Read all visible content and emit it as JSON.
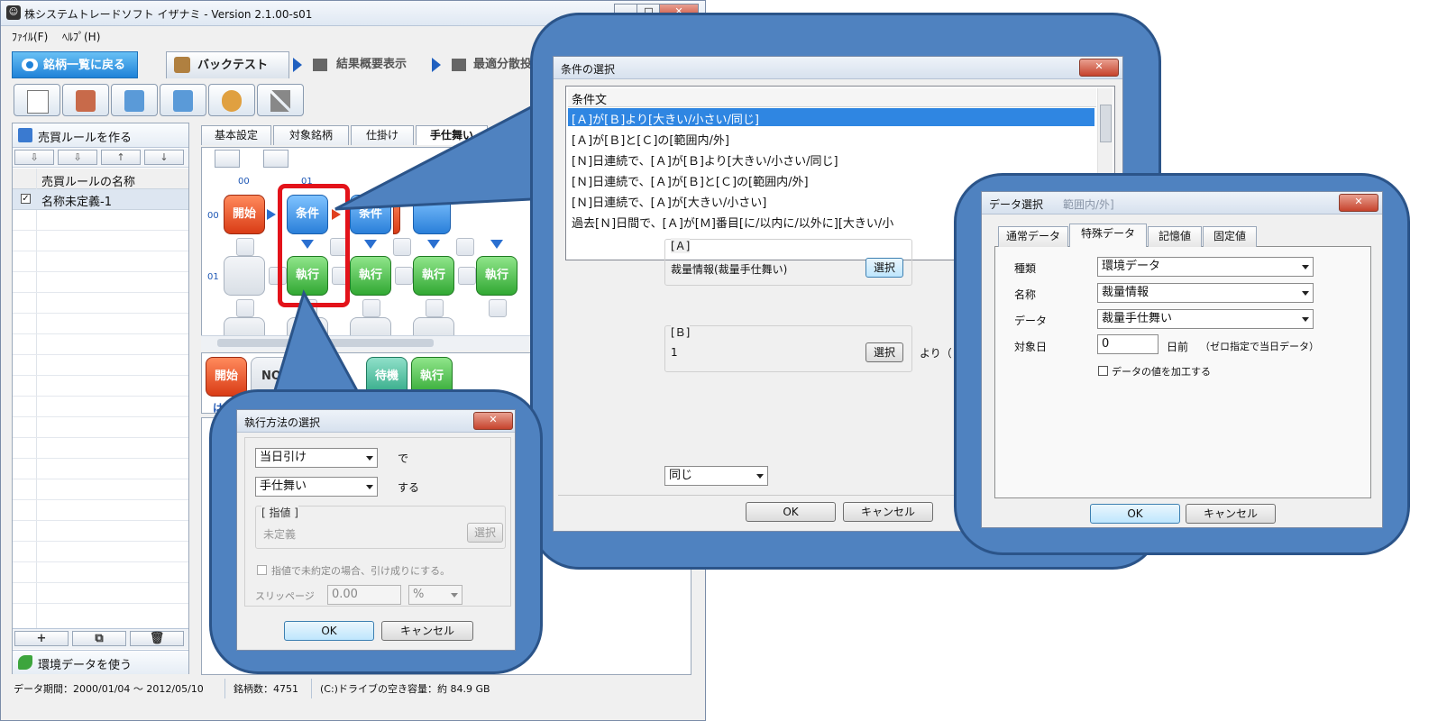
{
  "window": {
    "title": "株システムトレードソフト イザナミ - Version 2.1.00-s01",
    "min": "_",
    "max": "□",
    "close": "✕"
  },
  "menu": {
    "file": "ﾌｧｲﾙ(F)",
    "help": "ﾍﾙﾌﾟ(H)"
  },
  "nav": {
    "back": "銘柄一覧に戻る",
    "backtest": "バックテスト",
    "summary": "結果概要表示",
    "optimize": "最適分散投"
  },
  "left_panel": {
    "header": "売買ルールを作る",
    "column_header": "売買ルールの名称",
    "rows": [
      {
        "checked": true,
        "check_mark": "✓",
        "name": "名称未定義-1"
      }
    ],
    "tools": [
      "⇩",
      "⇩",
      "↑",
      "↓"
    ],
    "bottom_buttons": [
      "+",
      "⧉",
      "🗑"
    ],
    "footer": "環境データを使う"
  },
  "tabs": [
    "基本設定",
    "対象銘柄",
    "仕掛け",
    "手仕舞い"
  ],
  "grid": {
    "col_labels": [
      "00",
      "01"
    ],
    "row_labels": [
      "00",
      "01"
    ],
    "row0": [
      "開始",
      "条件",
      "条件",
      "",
      ""
    ],
    "row1": [
      "",
      "執行",
      "執行",
      "執行",
      "執行"
    ]
  },
  "palette": {
    "items": [
      "開始",
      "NO",
      "待機",
      "執行"
    ],
    "hint": "は"
  },
  "status": {
    "period": "データ期間：2000/01/04 〜 2012/05/10",
    "count": "銘柄数：4751",
    "disk": "(C:)ドライブの空き容量：約 84.9 GB"
  },
  "dialog_cond": {
    "title": "条件の選択",
    "list_header": "条件文",
    "items": [
      "[Ａ]が[Ｂ]より[大きい/小さい/同じ]",
      "[Ａ]が[Ｂ]と[Ｃ]の[範囲内/外]",
      "[Ｎ]日連続で、[Ａ]が[Ｂ]より[大きい/小さい/同じ]",
      "[Ｎ]日連続で、[Ａ]が[Ｂ]と[Ｃ]の[範囲内/外]",
      "[Ｎ]日連続で、[Ａ]が[大きい/小さい]",
      "過去[Ｎ]日間で、[Ａ]が[Ｍ]番目[に/以内に/以外に][大きい/小"
    ],
    "group_a_label": "[Ａ]",
    "group_a_value": "裁量情報(裁量手仕舞い)",
    "group_b_label": "[Ｂ]",
    "group_b_value": "1",
    "yori": "より（",
    "select_label": "選択",
    "compare": "同じ",
    "ok": "OK",
    "cancel": "キャンセル"
  },
  "dialog_data": {
    "title": "データ選択",
    "title_faded": "範囲内/外]",
    "tabs": [
      "通常データ",
      "特殊データ",
      "記憶値",
      "固定値"
    ],
    "type_label": "種類",
    "type_value": "環境データ",
    "name_label": "名称",
    "name_value": "裁量情報",
    "data_label": "データ",
    "data_value": "裁量手仕舞い",
    "date_label": "対象日",
    "date_value": "0",
    "date_suffix": "日前",
    "date_note": "（ゼロ指定で当日データ）",
    "process_label": "データの値を加工する",
    "ok": "OK",
    "cancel": "キャンセル"
  },
  "dialog_exec": {
    "title": "執行方法の選択",
    "timing": "当日引け",
    "de": "で",
    "method": "手仕舞い",
    "suru": "する",
    "limit_group": "[ 指値 ]",
    "limit_value": "未定義",
    "select_label": "選択",
    "unfilled_label": "指値で未約定の場合、引け成りにする。",
    "slippage_label": "スリッページ",
    "slippage_value": "0.00",
    "slippage_unit": "%",
    "ok": "OK",
    "cancel": "キャンセル"
  },
  "colors": {
    "accent": "#4f82c0",
    "highlight": "#e3131a",
    "selection": "#2f86e2"
  }
}
